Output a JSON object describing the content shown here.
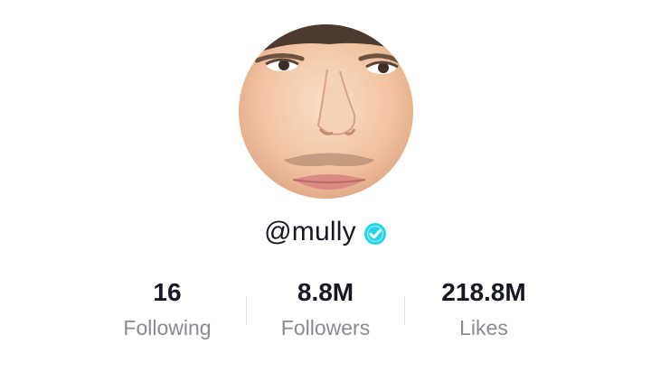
{
  "profile": {
    "username": "@mully",
    "verified": true,
    "avatar_icon": "user-avatar-photo",
    "verified_icon": "verified-badge-icon",
    "accent_color": "#20d5ec"
  },
  "stats": {
    "following": {
      "value": "16",
      "label": "Following"
    },
    "followers": {
      "value": "8.8M",
      "label": "Followers"
    },
    "likes": {
      "value": "218.8M",
      "label": "Likes"
    }
  },
  "colors": {
    "text_primary": "#161823",
    "text_secondary": "#8a8b91",
    "divider": "#e3e3e4",
    "background": "#ffffff"
  }
}
